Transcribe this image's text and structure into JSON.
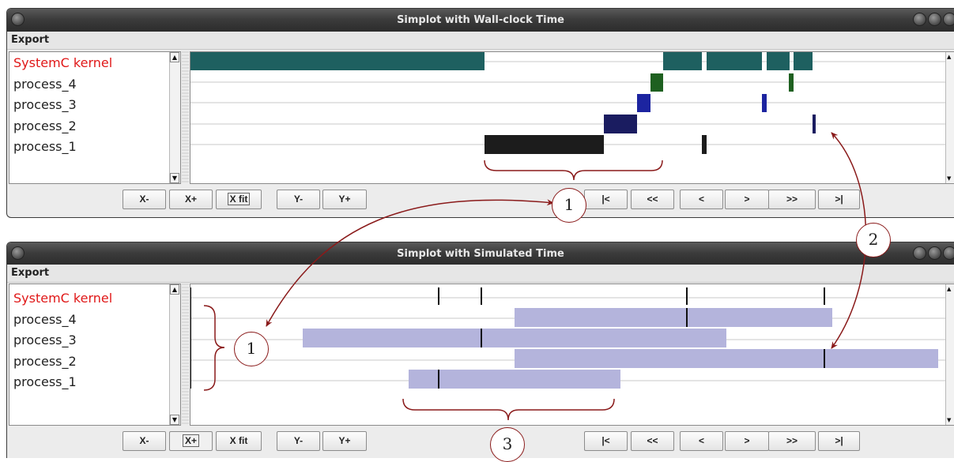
{
  "windows": [
    {
      "title": "Simplot with Wall-clock Time",
      "menu": "Export",
      "processes": [
        "SystemC kernel",
        "process_4",
        "process_3",
        "process_2",
        "process_1"
      ],
      "buttons_left": [
        "X-",
        "X+",
        "X fit",
        "Y-",
        "Y+"
      ],
      "buttons_right": [
        "|<",
        "<<",
        "<",
        ">",
        ">>",
        ">|"
      ]
    },
    {
      "title": "Simplot with Simulated Time",
      "menu": "Export",
      "processes": [
        "SystemC kernel",
        "process_4",
        "process_3",
        "process_2",
        "process_1"
      ],
      "buttons_left": [
        "X-",
        "X+",
        "X fit",
        "Y-",
        "Y+"
      ],
      "buttons_right": [
        "|<",
        "<<",
        "<",
        ">",
        ">>",
        ">|"
      ]
    }
  ],
  "annotations": {
    "label_1a": "1",
    "label_1b": "1",
    "label_2": "2",
    "label_3": "3"
  },
  "colors": {
    "kernel_text": "#e01818",
    "kernel_bar": "#1e6060",
    "process_4_bar": "#1e6020",
    "process_3_bar": "#1c24a0",
    "process_2_bar": "#1a1c60",
    "process_1_bar": "#1c1c1c",
    "simulated_bar": "#b4b4dc",
    "annotation": "#8a1a1a"
  }
}
